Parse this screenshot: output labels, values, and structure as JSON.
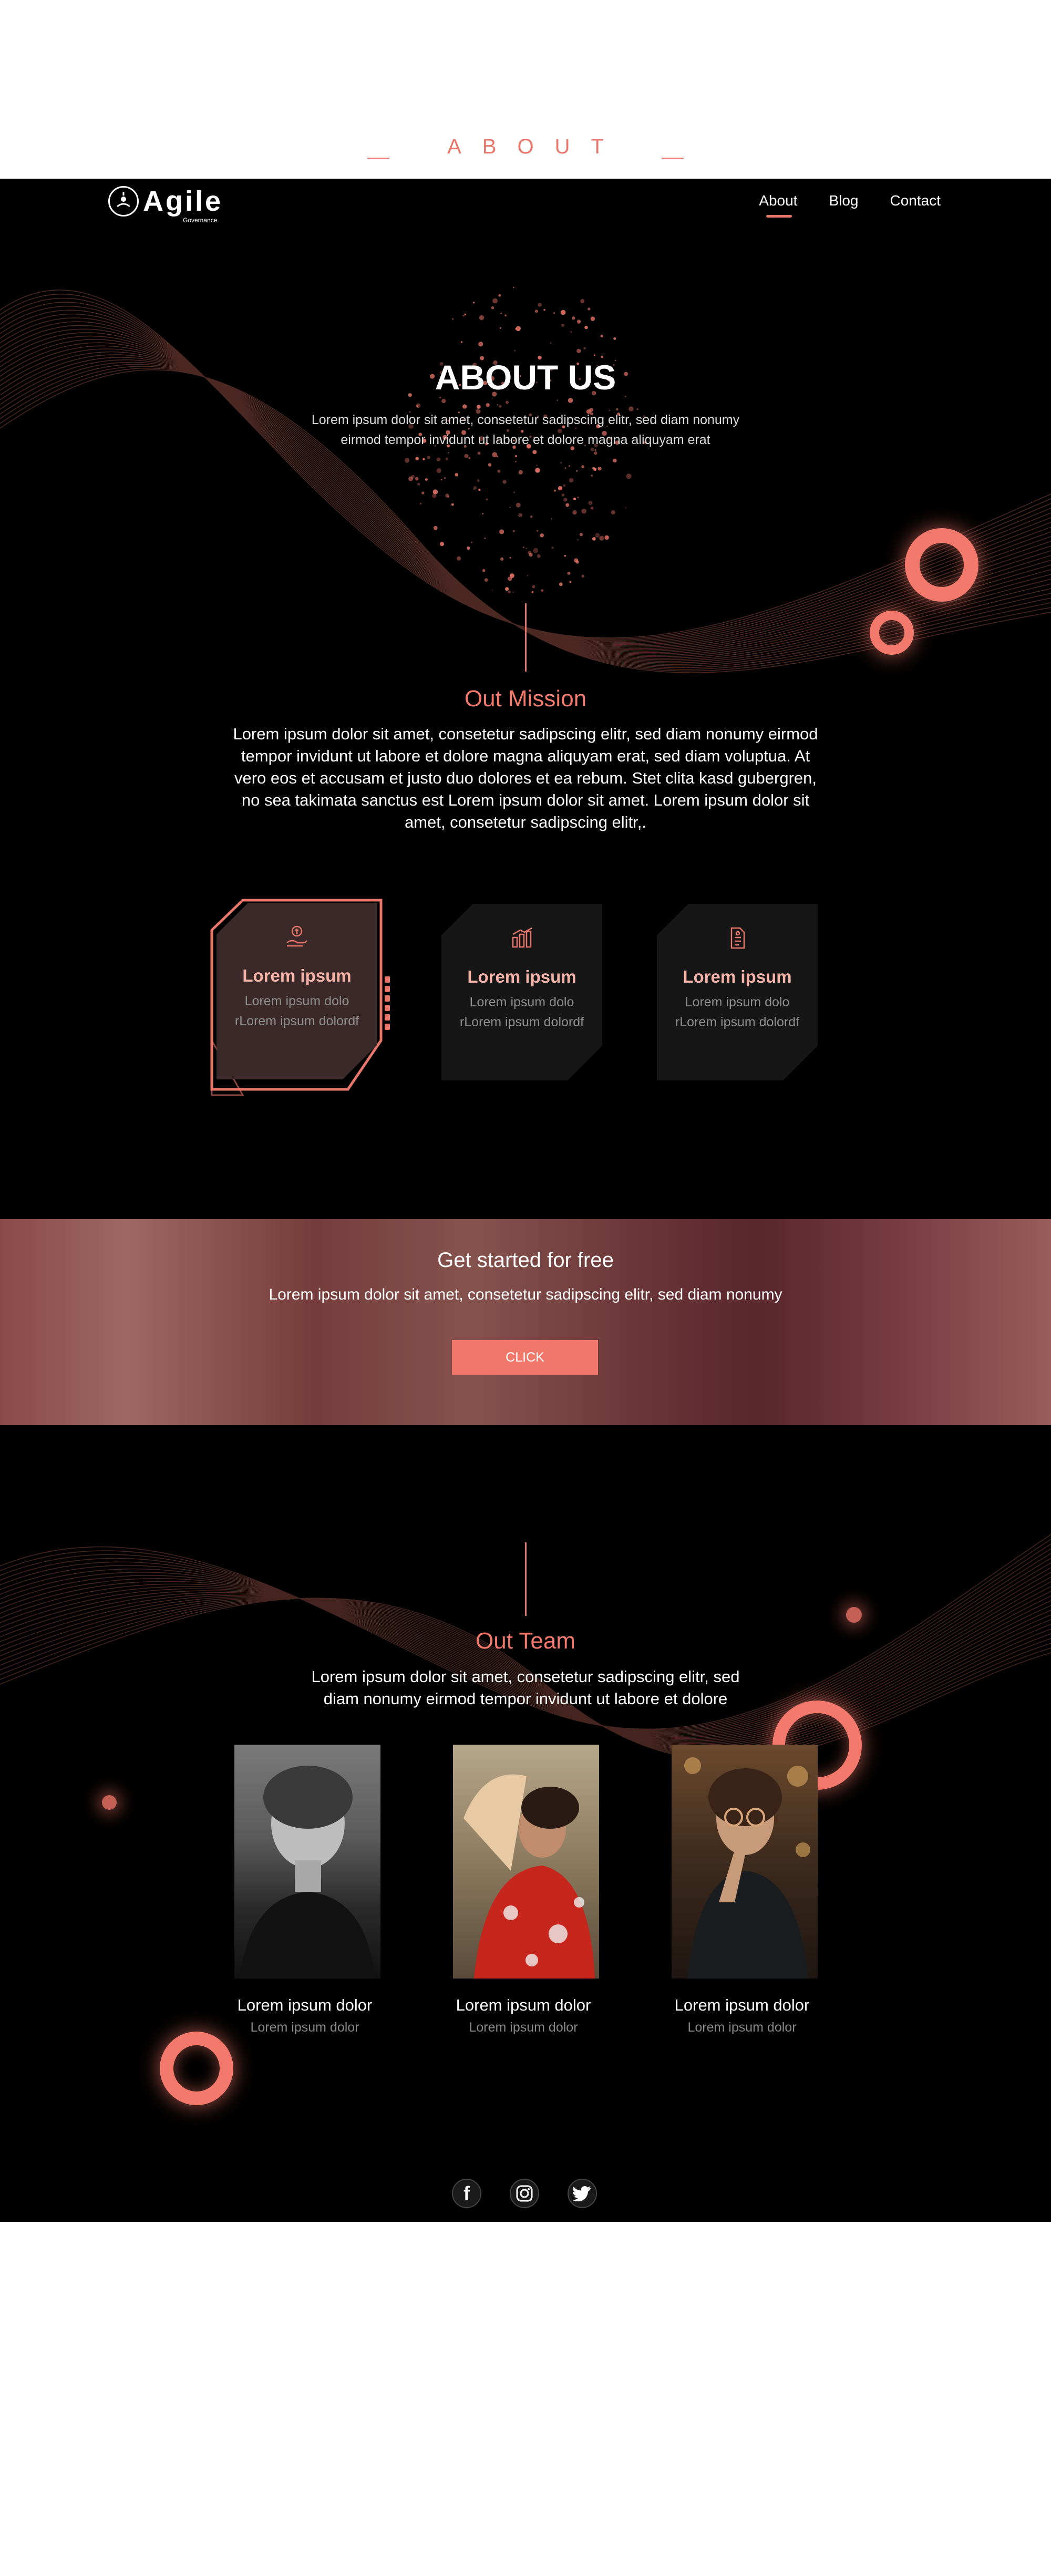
{
  "top_label": {
    "text": "ABOUT"
  },
  "brand": {
    "name": "Agile",
    "tagline": "Governance"
  },
  "nav": {
    "links": [
      {
        "label": "About",
        "active": true
      },
      {
        "label": "Blog",
        "active": false
      },
      {
        "label": "Contact",
        "active": false
      }
    ]
  },
  "hero": {
    "title": "ABOUT US",
    "text": "Lorem ipsum dolor sit amet, consetetur sadipscing elitr, sed diam nonumy eirmod tempor invidunt ut labore et dolore magna aliquyam erat"
  },
  "mission": {
    "title": "Out Mission",
    "text": "Lorem ipsum dolor sit amet, consetetur sadipscing elitr, sed diam nonumy eirmod tempor invidunt ut labore et dolore magna aliquyam erat, sed diam voluptua. At vero eos et accusam et justo duo dolores et ea rebum. Stet clita kasd gubergren, no sea takimata sanctus est Lorem ipsum dolor sit amet. Lorem ipsum dolor sit amet, consetetur sadipscing elitr,."
  },
  "cards": [
    {
      "icon": "hand-coin-icon",
      "title": "Lorem ipsum",
      "line1": "Lorem ipsum dolo",
      "line2": "rLorem ipsum dolordf"
    },
    {
      "icon": "bar-chart-icon",
      "title": "Lorem ipsum",
      "line1": "Lorem ipsum dolo",
      "line2": "rLorem ipsum dolordf"
    },
    {
      "icon": "document-icon",
      "title": "Lorem ipsum",
      "line1": "Lorem ipsum dolo",
      "line2": "rLorem ipsum dolordf"
    }
  ],
  "cta": {
    "title": "Get started for free",
    "text": "Lorem ipsum dolor sit amet, consetetur sadipscing elitr, sed diam nonumy",
    "button": "CLICK"
  },
  "team": {
    "title": "Out Team",
    "text": "Lorem ipsum dolor sit amet, consetetur sadipscing elitr, sed diam nonumy eirmod tempor invidunt ut labore et dolore",
    "members": [
      {
        "name": "Lorem ipsum dolor",
        "role": "Lorem ipsum dolor"
      },
      {
        "name": "Lorem ipsum dolor",
        "role": "Lorem ipsum dolor"
      },
      {
        "name": "Lorem ipsum dolor",
        "role": "Lorem ipsum dolor"
      }
    ]
  },
  "social": [
    {
      "icon": "facebook-icon",
      "glyph": "f"
    },
    {
      "icon": "instagram-icon",
      "glyph": ""
    },
    {
      "icon": "twitter-icon",
      "glyph": ""
    }
  ],
  "colors": {
    "accent": "#e8766a",
    "background": "#000000",
    "card": "#161616"
  }
}
